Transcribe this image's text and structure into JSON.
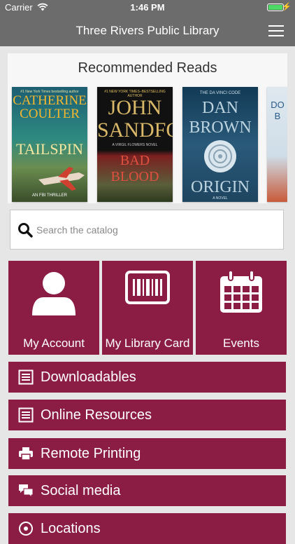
{
  "status_bar": {
    "carrier": "Carrier",
    "time": "1:46 PM",
    "battery_level": 1.0
  },
  "nav": {
    "title": "Three Rivers Public Library"
  },
  "recommended": {
    "heading": "Recommended Reads",
    "books": [
      {
        "tagline": "#1 New York Times bestselling author",
        "author": "CATHERINE COULTER",
        "title": "TAILSPIN",
        "footer": "AN FBI THRILLER"
      },
      {
        "tagline": "#1 NEW YORK TIMES–BESTSELLING AUTHOR",
        "author": "JOHN SANDFORD",
        "title": "BAD BLOOD",
        "footer": "A VIRGIL FLOWERS NOVEL"
      },
      {
        "tagline": "THE DA VINCI CODE",
        "author": "DAN BROWN",
        "title": "ORIGIN",
        "footer": "A NOVEL"
      },
      {
        "author": "DO",
        "title": "B"
      }
    ]
  },
  "search": {
    "placeholder": "Search the catalog"
  },
  "tiles": [
    {
      "label": "My Account",
      "icon": "person-icon"
    },
    {
      "label": "My Library Card",
      "icon": "barcode-icon"
    },
    {
      "label": "Events",
      "icon": "calendar-icon"
    }
  ],
  "menu": [
    {
      "label": "Downloadables",
      "icon": "document-icon"
    },
    {
      "label": "Online Resources",
      "icon": "document-icon"
    },
    {
      "label": "Remote Printing",
      "icon": "printer-icon"
    },
    {
      "label": "Social media",
      "icon": "chat-bubbles-icon"
    },
    {
      "label": "Locations",
      "icon": "location-pin-icon"
    }
  ],
  "colors": {
    "brand": "#8b1d44",
    "header": "#6c6c6c",
    "background": "#e6e6e6"
  }
}
